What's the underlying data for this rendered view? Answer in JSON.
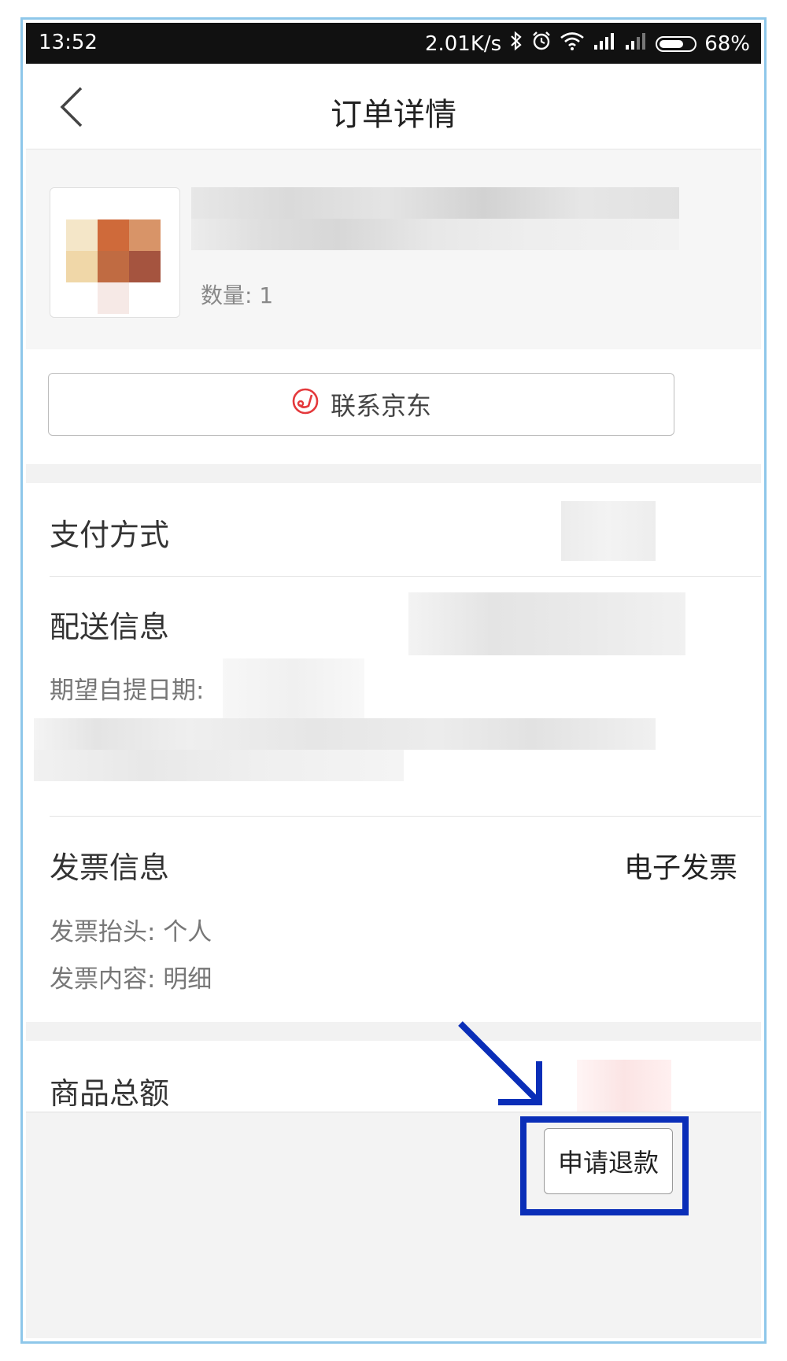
{
  "status_bar": {
    "time": "13:52",
    "network_speed": "2.01K/s",
    "battery": "68%",
    "battery_level": 0.68
  },
  "nav": {
    "title": "订单详情",
    "back_icon": "chevron-left-icon"
  },
  "product": {
    "quantity_label": "数量: 1"
  },
  "contact": {
    "label": "联系京东",
    "icon": "customer-service-icon",
    "icon_color": "#e4393c"
  },
  "payment": {
    "label": "支付方式"
  },
  "delivery": {
    "label": "配送信息",
    "pickup_date_label": "期望自提日期:"
  },
  "invoice": {
    "label": "发票信息",
    "value": "电子发票",
    "title_line": "发票抬头: 个人",
    "content_line": "发票内容: 明细"
  },
  "total": {
    "label": "商品总额"
  },
  "actions": {
    "refund_label": "申请退款"
  },
  "annotation": {
    "color": "#0a2eb8"
  }
}
